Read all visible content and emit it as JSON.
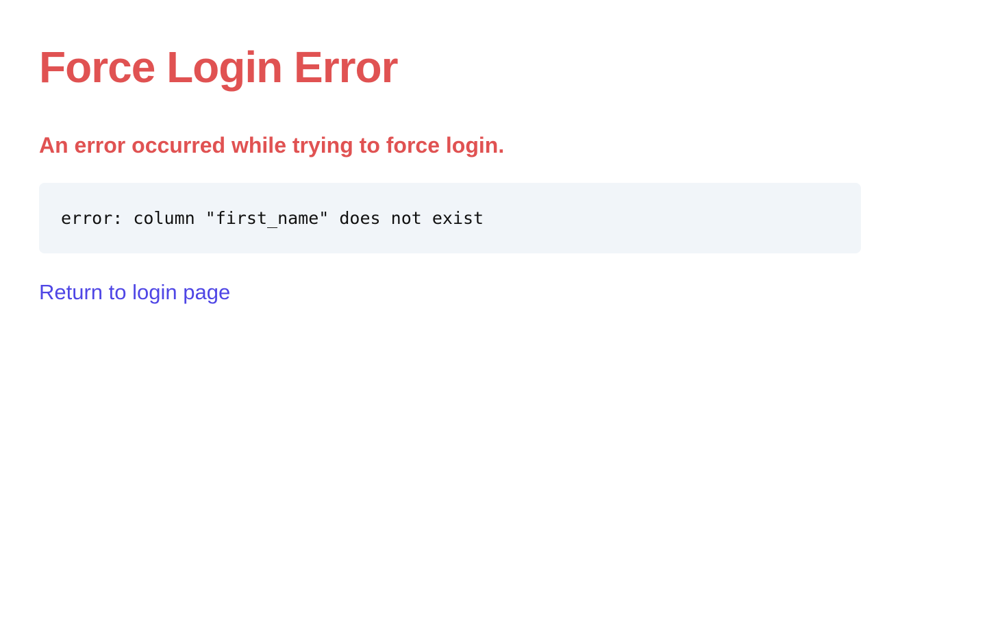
{
  "page": {
    "title": "Force Login Error",
    "subtitle": "An error occurred while trying to force login.",
    "error_message": "error: column \"first_name\" does not exist",
    "return_link_label": "Return to login page"
  },
  "colors": {
    "error_red": "#e05252",
    "link_indigo": "#4f46e5",
    "code_background": "#f1f5f9"
  }
}
